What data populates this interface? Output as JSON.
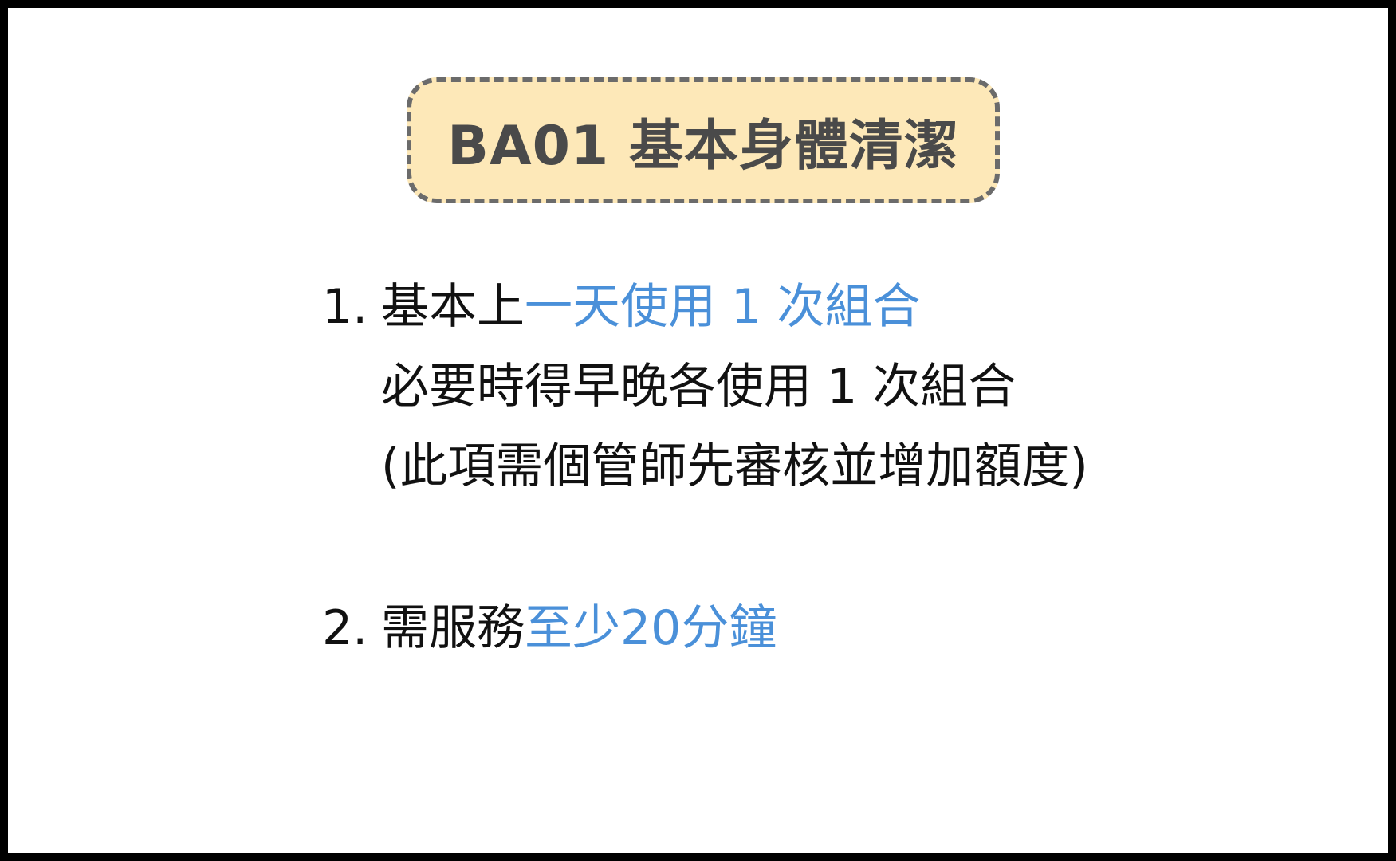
{
  "title": "BA01 基本身體清潔",
  "colors": {
    "highlight": "#4a90d9",
    "title_bg": "#fde8b8",
    "title_border": "#6b6b6b",
    "text": "#111111"
  },
  "items": [
    {
      "number": "1.",
      "prefix": "基本上",
      "highlight": "一天使用 1 次組合",
      "line2": "必要時得早晚各使用 1 次組合",
      "line3": "(此項需個管師先審核並增加額度)"
    },
    {
      "number": "2.",
      "prefix": "需服務",
      "highlight": "至少20分鐘"
    }
  ]
}
